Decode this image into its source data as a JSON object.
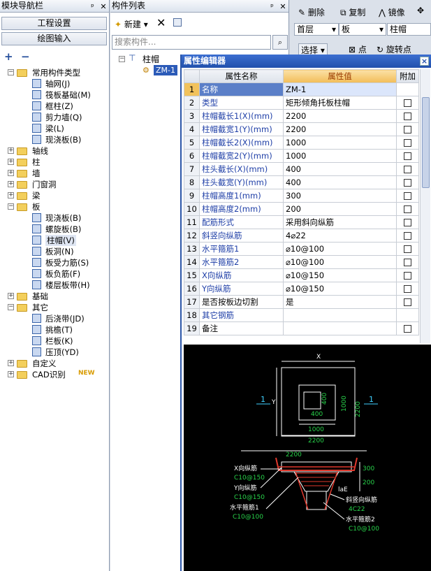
{
  "nav": {
    "title": "模块导航栏",
    "pin": "ᵖ",
    "close": "✕",
    "btn_project": "工程设置",
    "btn_draw": "绘图输入",
    "tool_add": "+",
    "tool_remove": "−",
    "tree": [
      {
        "label": "常用构件类型",
        "level": 0,
        "type": "folder",
        "state": "−"
      },
      {
        "label": "轴网(J)",
        "level": 1,
        "type": "item"
      },
      {
        "label": "筏板基础(M)",
        "level": 1,
        "type": "item"
      },
      {
        "label": "框柱(Z)",
        "level": 1,
        "type": "item"
      },
      {
        "label": "剪力墙(Q)",
        "level": 1,
        "type": "item"
      },
      {
        "label": "梁(L)",
        "level": 1,
        "type": "item"
      },
      {
        "label": "现浇板(B)",
        "level": 1,
        "type": "item"
      },
      {
        "label": "轴线",
        "level": 0,
        "type": "folder",
        "state": "+"
      },
      {
        "label": "柱",
        "level": 0,
        "type": "folder",
        "state": "+"
      },
      {
        "label": "墙",
        "level": 0,
        "type": "folder",
        "state": "+"
      },
      {
        "label": "门窗洞",
        "level": 0,
        "type": "folder",
        "state": "+"
      },
      {
        "label": "梁",
        "level": 0,
        "type": "folder",
        "state": "+"
      },
      {
        "label": "板",
        "level": 0,
        "type": "folder",
        "state": "−"
      },
      {
        "label": "现浇板(B)",
        "level": 1,
        "type": "item"
      },
      {
        "label": "螺旋板(B)",
        "level": 1,
        "type": "item"
      },
      {
        "label": "柱帽(V)",
        "level": 1,
        "type": "item",
        "selected": true
      },
      {
        "label": "板洞(N)",
        "level": 1,
        "type": "item"
      },
      {
        "label": "板受力筋(S)",
        "level": 1,
        "type": "item"
      },
      {
        "label": "板负筋(F)",
        "level": 1,
        "type": "item"
      },
      {
        "label": "楼层板带(H)",
        "level": 1,
        "type": "item"
      },
      {
        "label": "基础",
        "level": 0,
        "type": "folder",
        "state": "+"
      },
      {
        "label": "其它",
        "level": 0,
        "type": "folder",
        "state": "−"
      },
      {
        "label": "后浇带(JD)",
        "level": 1,
        "type": "item"
      },
      {
        "label": "挑檐(T)",
        "level": 1,
        "type": "item"
      },
      {
        "label": "栏板(K)",
        "level": 1,
        "type": "item"
      },
      {
        "label": "压顶(YD)",
        "level": 1,
        "type": "item"
      },
      {
        "label": "自定义",
        "level": 0,
        "type": "folder",
        "state": "+"
      },
      {
        "label": "CAD识别",
        "level": 0,
        "type": "folder",
        "state": "+",
        "badge": "NEW"
      }
    ]
  },
  "comp": {
    "title": "构件列表",
    "new_label": "新建",
    "search_placeholder": "搜索构件...",
    "tree_root": "柱帽",
    "tree_item": "ZM-1"
  },
  "toolbar": {
    "delete": "删除",
    "copy": "复制",
    "mirror": "镜像",
    "floor": "首层",
    "category": "板",
    "type": "柱帽",
    "select": "选择",
    "point": "点",
    "rotate_point": "旋转点"
  },
  "prop": {
    "title": "属性编辑器",
    "close": "×",
    "col_name": "属性名称",
    "col_value": "属性值",
    "col_add": "附加",
    "rows": [
      {
        "n": "1",
        "name": "名称",
        "value": "ZM-1",
        "blue": true,
        "cb": false,
        "sel": true
      },
      {
        "n": "2",
        "name": "类型",
        "value": "矩形倾角托板柱帽",
        "blue": true,
        "cb": true
      },
      {
        "n": "3",
        "name": "柱帽截长1(X)(mm)",
        "value": "2200",
        "blue": true,
        "cb": true
      },
      {
        "n": "4",
        "name": "柱帽截宽1(Y)(mm)",
        "value": "2200",
        "blue": true,
        "cb": true
      },
      {
        "n": "5",
        "name": "柱帽截长2(X)(mm)",
        "value": "1000",
        "blue": true,
        "cb": true
      },
      {
        "n": "6",
        "name": "柱帽截宽2(Y)(mm)",
        "value": "1000",
        "blue": true,
        "cb": true
      },
      {
        "n": "7",
        "name": "柱头截长(X)(mm)",
        "value": "400",
        "blue": true,
        "cb": true
      },
      {
        "n": "8",
        "name": "柱头截宽(Y)(mm)",
        "value": "400",
        "blue": true,
        "cb": true
      },
      {
        "n": "9",
        "name": "柱帽高度1(mm)",
        "value": "300",
        "blue": true,
        "cb": true
      },
      {
        "n": "10",
        "name": "柱帽高度2(mm)",
        "value": "200",
        "blue": true,
        "cb": true
      },
      {
        "n": "11",
        "name": "配筋形式",
        "value": "采用斜向纵筋",
        "blue": true,
        "cb": true
      },
      {
        "n": "12",
        "name": "斜竖向纵筋",
        "value": "4⌀22",
        "blue": true,
        "cb": true
      },
      {
        "n": "13",
        "name": "水平箍筋1",
        "value": "⌀10@100",
        "blue": true,
        "cb": true
      },
      {
        "n": "14",
        "name": "水平箍筋2",
        "value": "⌀10@100",
        "blue": true,
        "cb": true
      },
      {
        "n": "15",
        "name": "X向纵筋",
        "value": "⌀10@150",
        "blue": true,
        "cb": true
      },
      {
        "n": "16",
        "name": "Y向纵筋",
        "value": "⌀10@150",
        "blue": true,
        "cb": true
      },
      {
        "n": "17",
        "name": "是否按板边切割",
        "value": "是",
        "blue": false,
        "cb": true
      },
      {
        "n": "18",
        "name": "其它钢筋",
        "value": "",
        "blue": true,
        "cb": false
      },
      {
        "n": "19",
        "name": "备注",
        "value": "",
        "blue": false,
        "cb": true
      }
    ]
  },
  "cad": {
    "dim_x": "X",
    "dim_y": "Y",
    "dim_400_h": "400",
    "dim_400_v": "400",
    "dim_1000_v": "1000",
    "dim_2200_v": "2200",
    "dim_1000_h": "1000",
    "dim_2200_h": "2200",
    "section_left": "1",
    "section_right": "1",
    "dim_2200_sec": "2200",
    "dim_300": "300",
    "dim_200": "200",
    "lae": "laE",
    "x_rebar_label": "X向纵筋",
    "x_rebar_val": "C10@150",
    "y_rebar_label": "Y向纵筋",
    "y_rebar_val": "C10@150",
    "h1_label": "水平箍筋1",
    "h1_val": "C10@100",
    "slant_label": "斜竖向纵筋",
    "slant_val": "4C22",
    "h2_label": "水平箍筋2",
    "h2_val": "C10@100",
    "colors": {
      "white": "#ffffff",
      "green": "#28d24a",
      "red": "#e0392d",
      "cyan": "#3fd0ff"
    }
  }
}
